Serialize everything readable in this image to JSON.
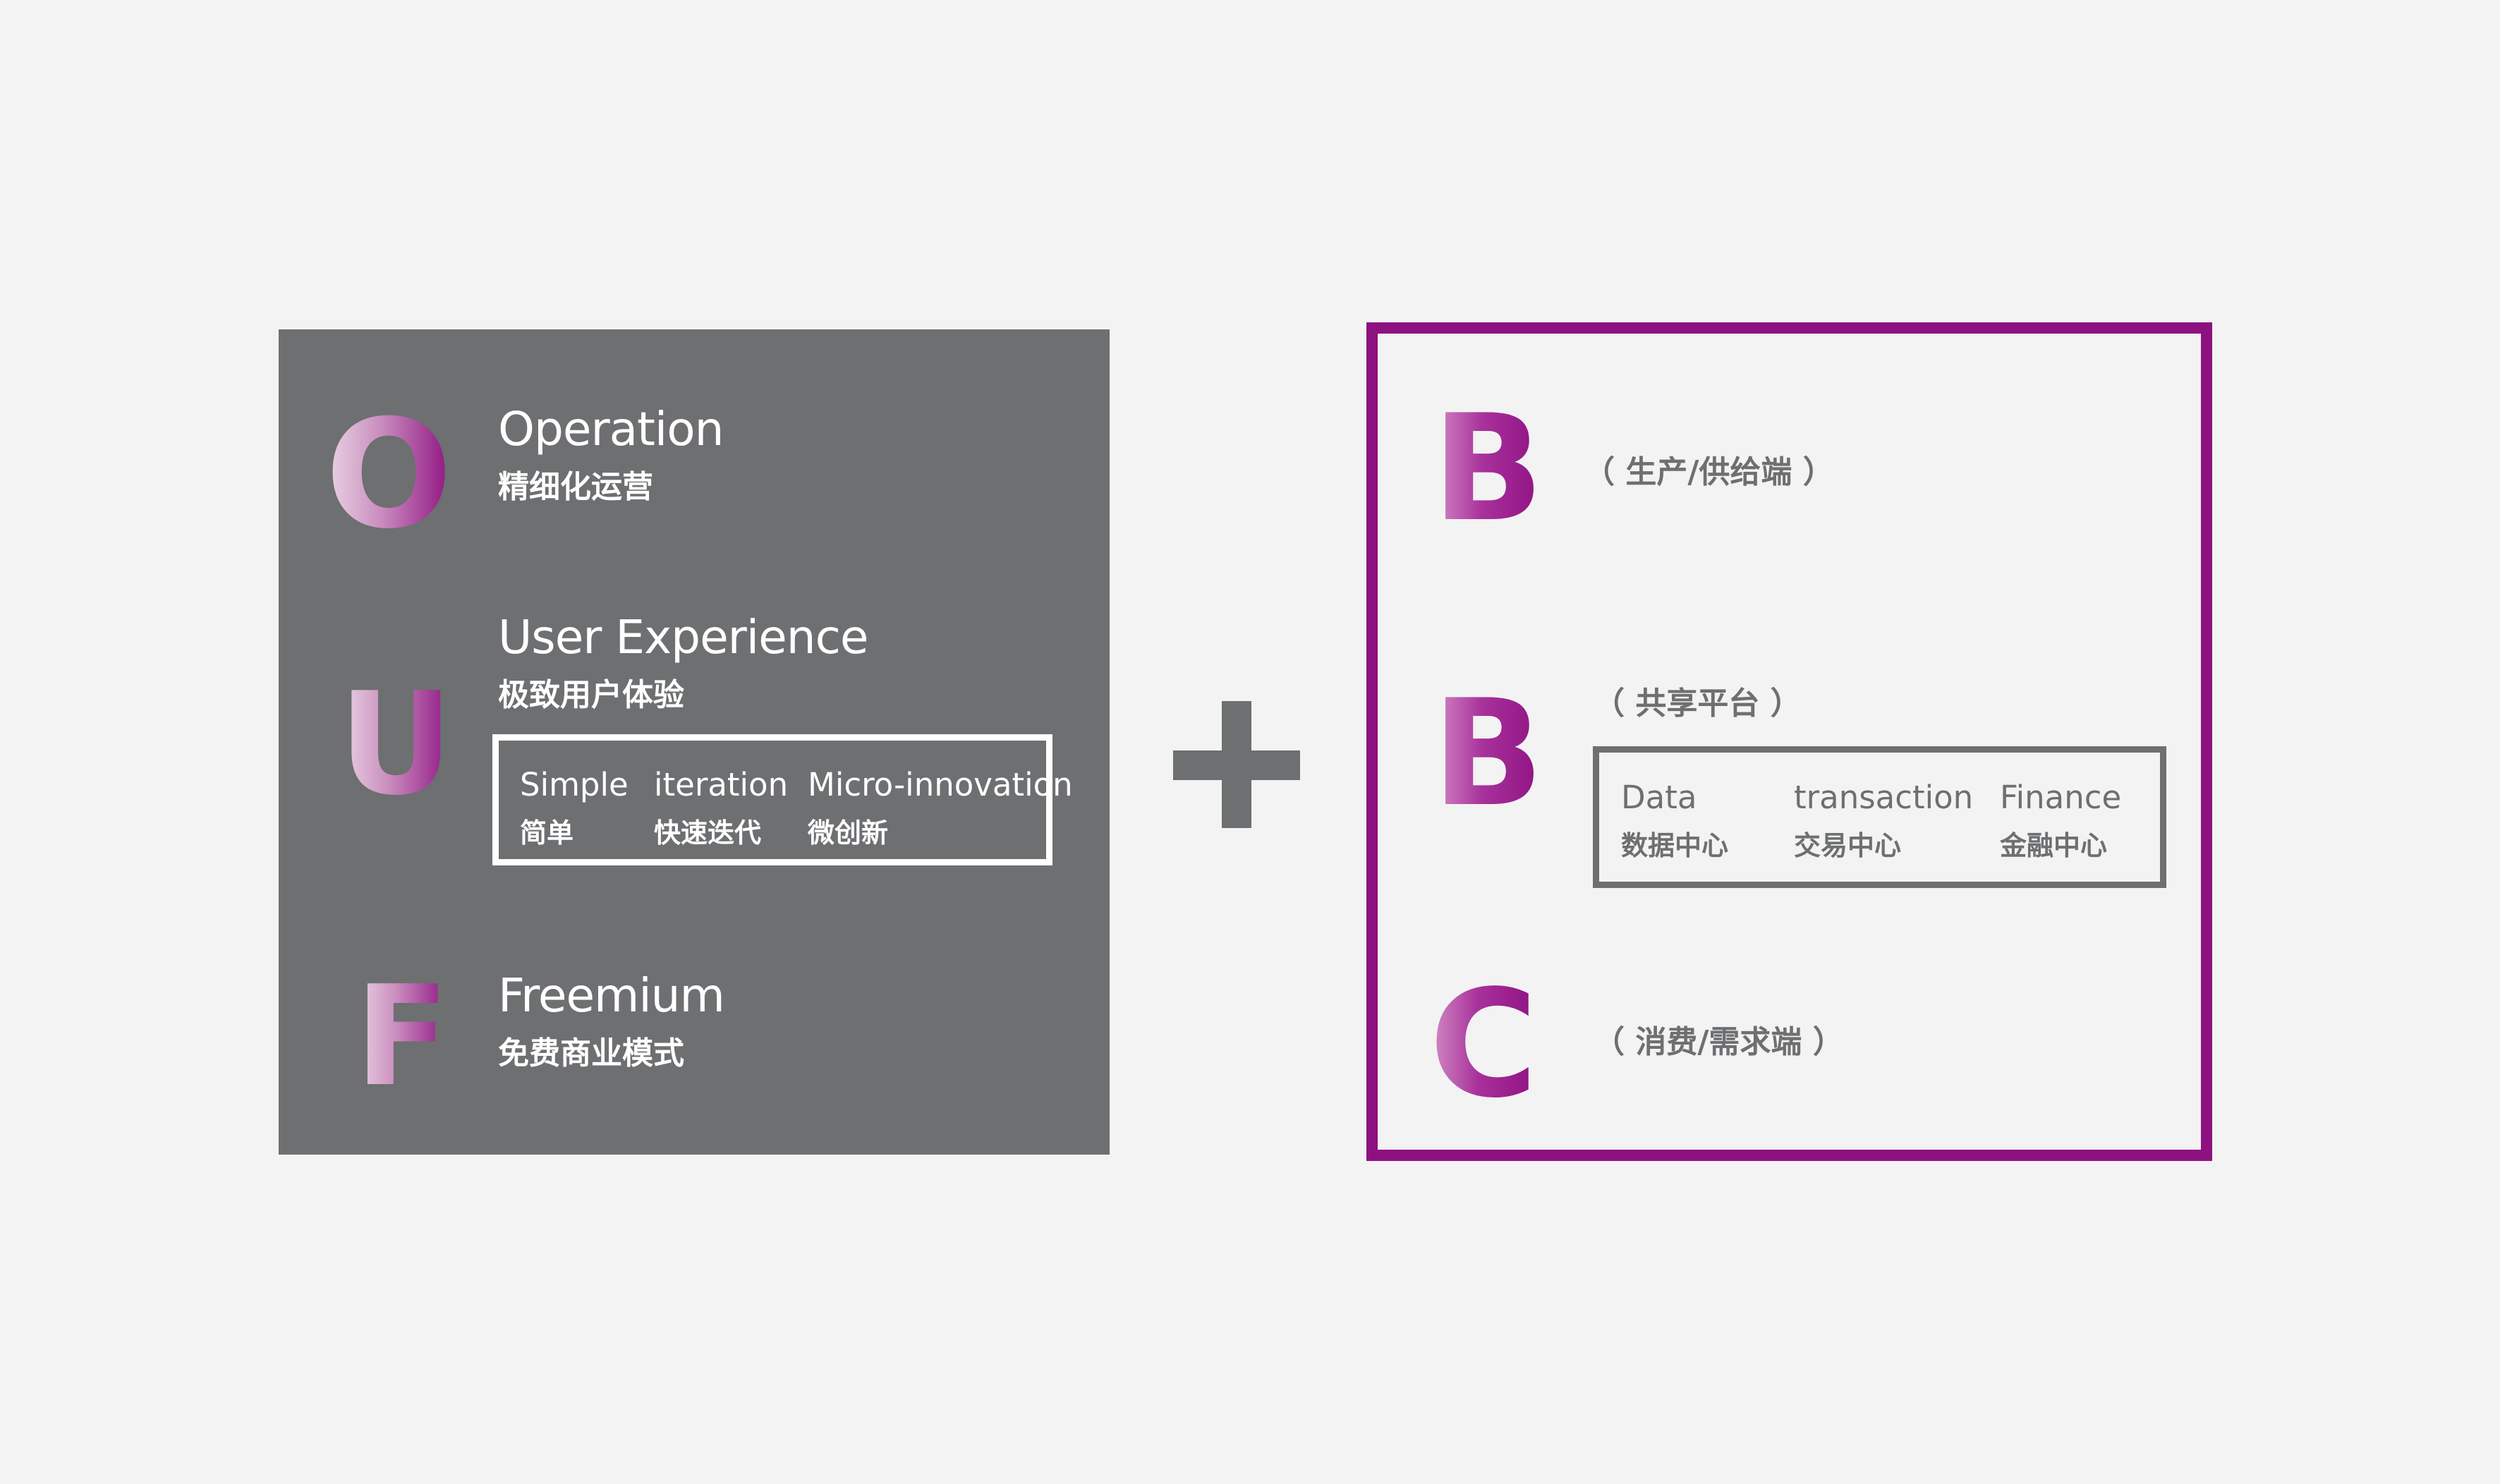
{
  "ouf": {
    "items": [
      {
        "letter": "O",
        "title": "Operation",
        "subtitle": "精细化运营"
      },
      {
        "letter": "U",
        "title": "User Experience",
        "subtitle": "极致用户体验"
      },
      {
        "letter": "F",
        "title": "Freemium",
        "subtitle": "免费商业模式"
      }
    ],
    "ux_box": [
      {
        "en": "Simple",
        "zh": "简单"
      },
      {
        "en": "iteration",
        "zh": "快速迭代"
      },
      {
        "en": "Micro-innovation",
        "zh": "微创新"
      }
    ]
  },
  "plus": "+",
  "bbc": {
    "items": [
      {
        "letter": "B",
        "note": "（ 生产/供给端 ）"
      },
      {
        "letter": "B",
        "note": "（ 共享平台 ）"
      },
      {
        "letter": "C",
        "note": "（ 消费/需求端 ）"
      }
    ],
    "center_box": [
      {
        "en": "Data",
        "zh": "数据中心"
      },
      {
        "en": "transaction",
        "zh": "交易中心"
      },
      {
        "en": "Finance",
        "zh": "金融中心"
      }
    ]
  },
  "colors": {
    "background": "#f3f3f3",
    "panel_grey": "#6d6f71",
    "accent_purple": "#8e1182",
    "gradient_light": "#ead6e6"
  }
}
